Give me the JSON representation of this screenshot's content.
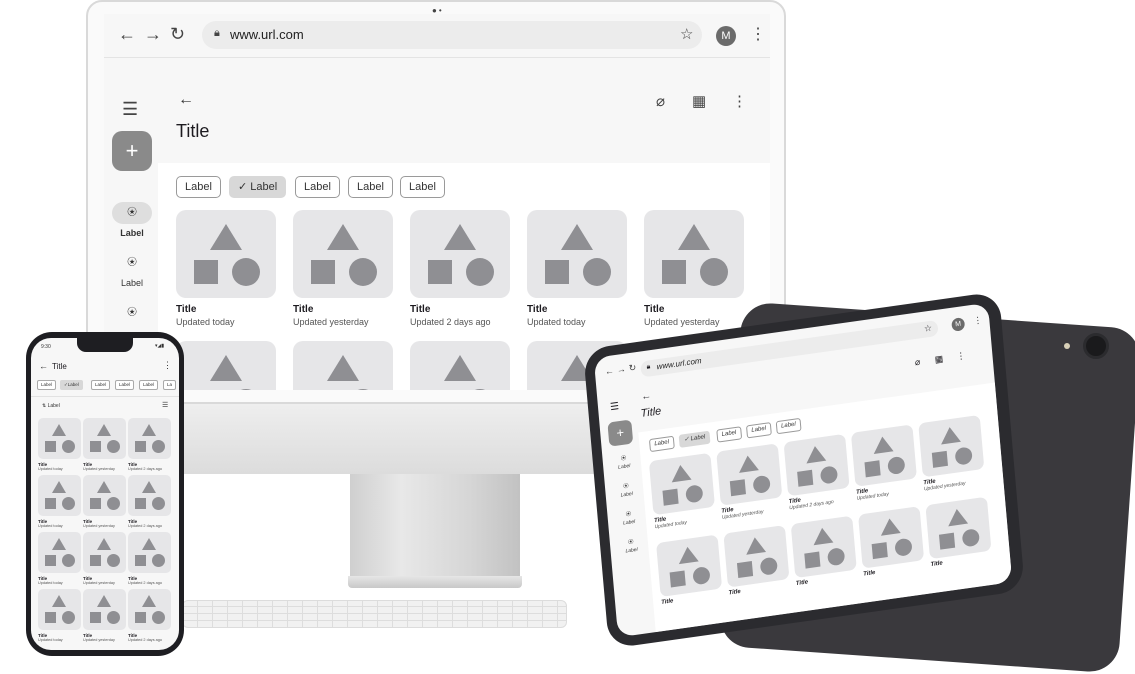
{
  "desktop": {
    "browser": {
      "url": "www.url.com",
      "avatar_initial": "M",
      "icons": [
        "back-arrow-icon",
        "forward-arrow-icon",
        "reload-icon",
        "lock-icon",
        "star-icon",
        "kebab-menu-icon"
      ]
    },
    "app": {
      "title": "Title",
      "top_actions": [
        "attach-icon",
        "calendar-icon",
        "more-vert-icon"
      ],
      "fab_label": "+",
      "rail": [
        {
          "label": "Label",
          "icon": "star-circle-icon",
          "active": true
        },
        {
          "label": "Label",
          "icon": "star-circle-icon",
          "active": false
        },
        {
          "label": "",
          "icon": "star-circle-icon",
          "active": false
        }
      ],
      "chips": [
        {
          "label": "Label",
          "selected": false
        },
        {
          "label": "Label",
          "selected": true,
          "check": "✓"
        },
        {
          "label": "Label",
          "selected": false
        },
        {
          "label": "Label",
          "selected": false
        },
        {
          "label": "Label",
          "selected": false
        }
      ],
      "cards_row1": [
        {
          "title": "Title",
          "subtitle": "Updated today"
        },
        {
          "title": "Title",
          "subtitle": "Updated yesterday"
        },
        {
          "title": "Title",
          "subtitle": "Updated 2 days ago"
        },
        {
          "title": "Title",
          "subtitle": "Updated today"
        },
        {
          "title": "Title",
          "subtitle": "Updated yesterday"
        }
      ]
    }
  },
  "phone": {
    "status_time": "9:30",
    "status_icons": "▾◢▮",
    "title": "Title",
    "chips": [
      "Label",
      "Label",
      "Label",
      "Label",
      "Label",
      "La"
    ],
    "selected_chip_index": 1,
    "sort_label": "Label",
    "cards": [
      {
        "title": "Title",
        "subtitle": "Updated today"
      },
      {
        "title": "Title",
        "subtitle": "Updated yesterday"
      },
      {
        "title": "Title",
        "subtitle": "Updated 2 days ago"
      },
      {
        "title": "Title",
        "subtitle": "Updated today"
      },
      {
        "title": "Title",
        "subtitle": "Updated yesterday"
      },
      {
        "title": "Title",
        "subtitle": "Updated 2 days ago"
      },
      {
        "title": "Title",
        "subtitle": "Updated today"
      },
      {
        "title": "Title",
        "subtitle": "Updated yesterday"
      },
      {
        "title": "Title",
        "subtitle": "Updated 2 days ago"
      },
      {
        "title": "Title",
        "subtitle": "Updated today"
      },
      {
        "title": "Title",
        "subtitle": "Updated yesterday"
      },
      {
        "title": "Title",
        "subtitle": "Updated 2 days ago"
      }
    ]
  },
  "tablet": {
    "url": "www.url.com",
    "avatar_initial": "M",
    "title": "Title",
    "chips": [
      "Label",
      "Label",
      "Label",
      "Label",
      "Label"
    ],
    "selected_chip_index": 1,
    "rail_labels": [
      "Label",
      "Label",
      "Label",
      "Label"
    ],
    "cards_row1": [
      {
        "title": "Title",
        "subtitle": "Updated today"
      },
      {
        "title": "Title",
        "subtitle": "Updated yesterday"
      },
      {
        "title": "Title",
        "subtitle": "Updated 2 days ago"
      },
      {
        "title": "Title",
        "subtitle": "Updated today"
      },
      {
        "title": "Title",
        "subtitle": "Updated yesterday"
      }
    ],
    "cards_row2_titles": [
      "Title",
      "Title",
      "Title",
      "Title",
      "Title"
    ]
  }
}
